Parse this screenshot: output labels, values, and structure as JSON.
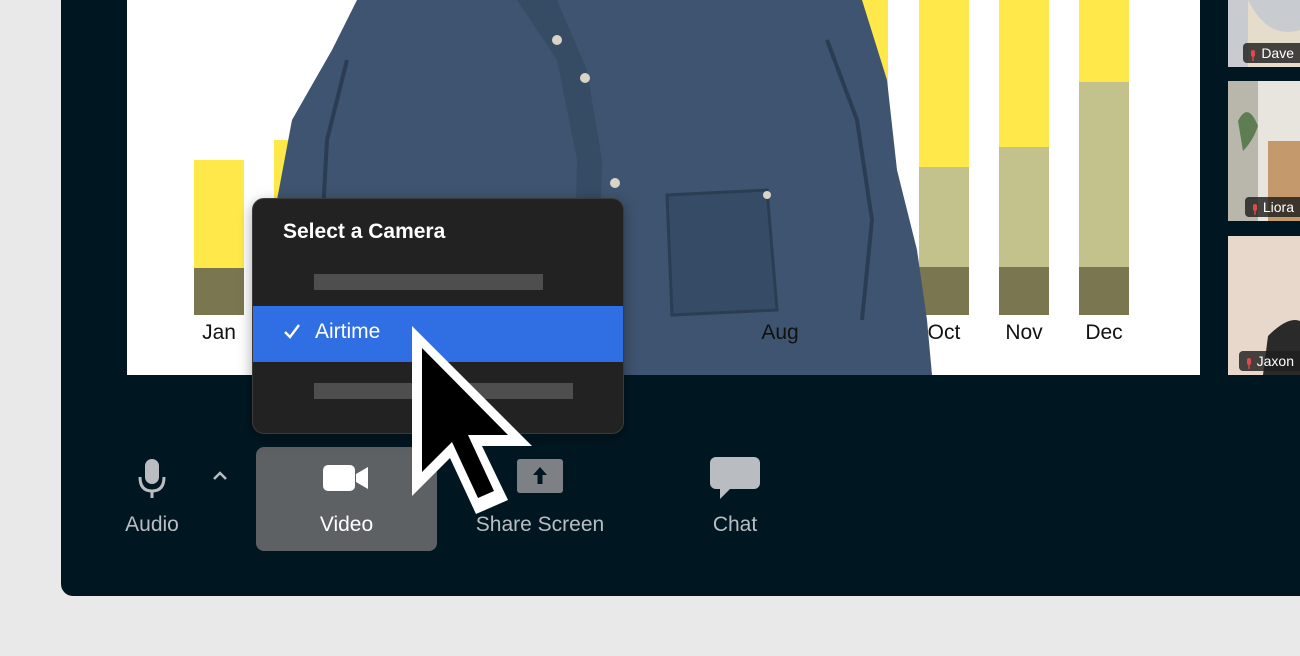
{
  "presentation": {
    "months": [
      "Jan",
      "Aug",
      "Oct",
      "Nov",
      "Dec"
    ]
  },
  "participants": [
    {
      "name": "Dave"
    },
    {
      "name": "Liora"
    },
    {
      "name": "Jaxon"
    }
  ],
  "camera_menu": {
    "title": "Select a Camera",
    "selected": "Airtime"
  },
  "toolbar": {
    "audio_label": "Audio",
    "video_label": "Video",
    "share_label": "Share Screen",
    "chat_label": "Chat"
  },
  "colors": {
    "app_background": "#001722",
    "bar_yellow": "#ffe94a",
    "bar_olive_light": "#c4c28c",
    "bar_olive_dark": "#7a7750",
    "menu_selected": "#2f6ee3"
  },
  "icons": [
    "microphone-icon",
    "chevron-up-icon",
    "video-camera-icon",
    "share-screen-icon",
    "chat-icon",
    "checkmark-icon",
    "mic-muted-icon",
    "mouse-pointer-icon"
  ]
}
